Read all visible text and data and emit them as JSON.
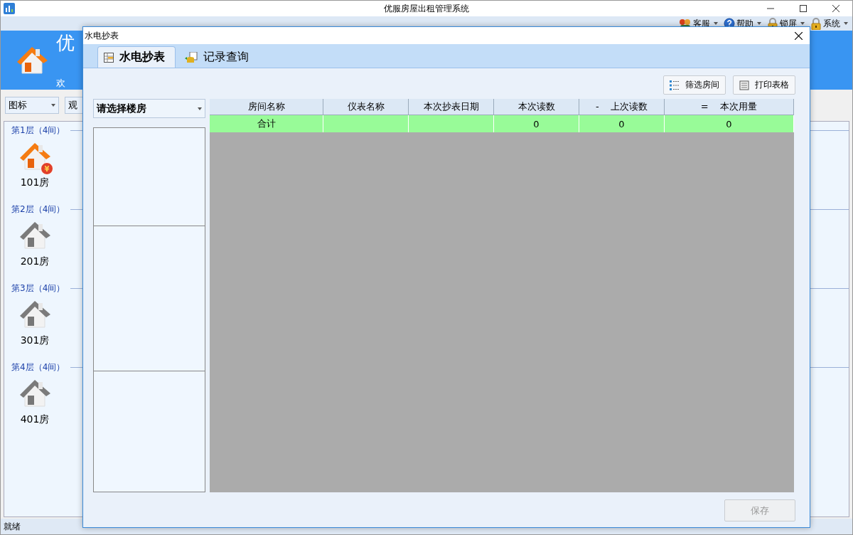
{
  "window": {
    "title": "优服房屋出租管理系统"
  },
  "menu": [
    {
      "label": "客服",
      "kind": "people"
    },
    {
      "label": "帮助",
      "kind": "help"
    },
    {
      "label": "锁屏",
      "kind": "lock"
    },
    {
      "label": "系统",
      "kind": "lock"
    }
  ],
  "banner": {
    "title": "优",
    "subtitle": "欢"
  },
  "toolbar": {
    "view_select": "图标",
    "filter_select": "观"
  },
  "floors": [
    {
      "label": "第1层（4间）",
      "rooms": [
        {
          "name": "101房",
          "occupied": true,
          "badge": "¥"
        }
      ]
    },
    {
      "label": "第2层（4间）",
      "rooms": [
        {
          "name": "201房",
          "occupied": false
        }
      ]
    },
    {
      "label": "第3层（4间）",
      "rooms": [
        {
          "name": "301房",
          "occupied": false
        }
      ]
    },
    {
      "label": "第4层（4间）",
      "rooms": [
        {
          "name": "401房",
          "occupied": false
        }
      ]
    }
  ],
  "status_bar": "就绪",
  "dialog": {
    "title": "水电抄表",
    "tabs": [
      {
        "label": "水电抄表",
        "selected": true
      },
      {
        "label": "记录查询",
        "selected": false
      }
    ],
    "actions": [
      {
        "label": "筛选房间",
        "kind": "filter"
      },
      {
        "label": "打印表格",
        "kind": "print"
      }
    ],
    "building_select": {
      "placeholder": "请选择楼房"
    },
    "table": {
      "columns": [
        "房间名称",
        "仪表名称",
        "本次抄表日期",
        "本次读数",
        "-    上次读数",
        "=    本次用量"
      ],
      "rows": [
        {
          "cells": [
            "合计",
            "",
            "",
            "0",
            "0",
            "0"
          ],
          "kind": "total"
        }
      ]
    },
    "save_button": {
      "label": "保存",
      "disabled": true
    }
  }
}
